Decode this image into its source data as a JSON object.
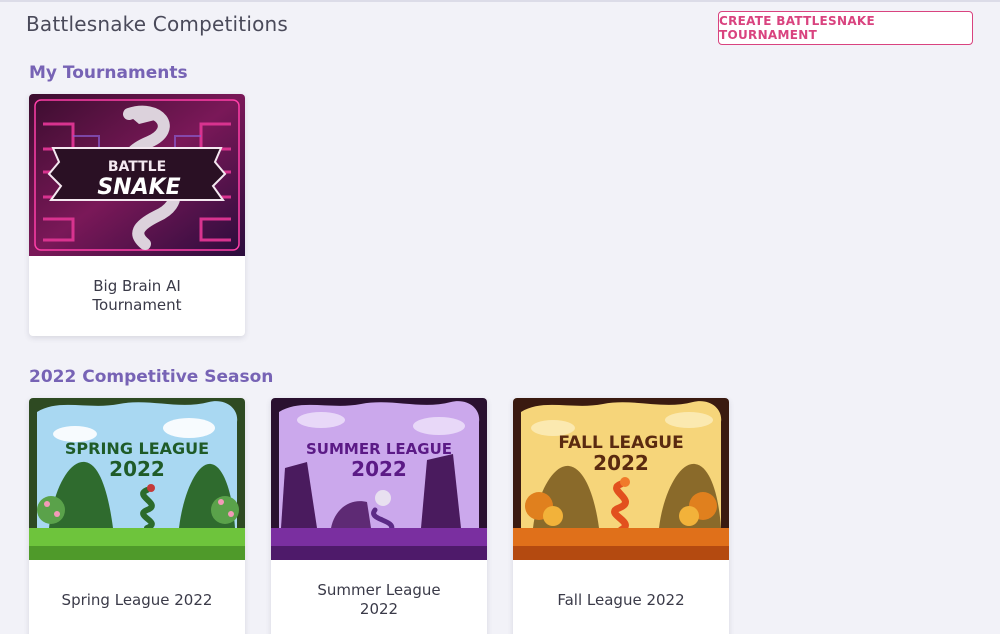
{
  "header": {
    "title": "Battlesnake Competitions",
    "create_label": "CREATE BATTLESNAKE TOURNAMENT"
  },
  "sections": [
    {
      "title": "My Tournaments",
      "cards": [
        {
          "label": "Big Brain AI Tournament",
          "art_text": [
            "BATTLE",
            "SNAKE"
          ]
        }
      ]
    },
    {
      "title": "2022 Competitive Season",
      "cards": [
        {
          "label": "Spring League 2022",
          "art_line1": "SPRING LEAGUE",
          "art_line2": "2022"
        },
        {
          "label": "Summer League 2022",
          "art_line1": "SUMMER LEAGUE",
          "art_line2": "2022"
        },
        {
          "label": "Fall League 2022",
          "art_line1": "FALL LEAGUE",
          "art_line2": "2022"
        }
      ]
    }
  ],
  "colors": {
    "accent": "#d9437f",
    "section_title": "#7763b5",
    "background": "#f2f2f8"
  }
}
